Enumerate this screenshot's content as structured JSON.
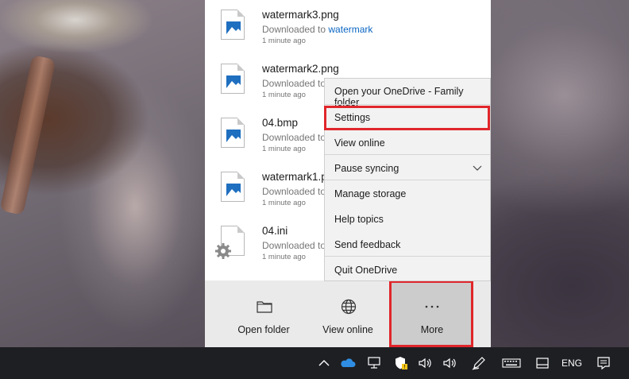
{
  "files": [
    {
      "name": "watermark3.png",
      "status_prefix": "Downloaded to ",
      "location": "watermark",
      "time": "1 minute ago",
      "icon": "image-file-icon"
    },
    {
      "name": "watermark2.png",
      "status_prefix": "Downloaded to",
      "location": "",
      "time": "1 minute ago",
      "icon": "image-file-icon"
    },
    {
      "name": "04.bmp",
      "status_prefix": "Downloaded to",
      "location": "",
      "time": "1 minute ago",
      "icon": "image-file-icon"
    },
    {
      "name": "watermark1.p",
      "status_prefix": "Downloaded to",
      "location": "",
      "time": "1 minute ago",
      "icon": "image-file-icon"
    },
    {
      "name": "04.ini",
      "status_prefix": "Downloaded to",
      "location": "",
      "time": "1 minute ago",
      "icon": "settings-file-icon"
    }
  ],
  "actions": {
    "open_folder": {
      "label": "Open folder",
      "icon": "folder-icon"
    },
    "view_online": {
      "label": "View online",
      "icon": "globe-icon"
    },
    "more": {
      "label": "More",
      "icon": "ellipsis-icon"
    }
  },
  "menu": {
    "items": [
      {
        "label": "Open your OneDrive - Family folder"
      },
      {
        "label": "Settings"
      },
      {
        "label": "View online"
      },
      {
        "label": "Pause syncing",
        "has_submenu": true
      },
      {
        "label": "Manage storage"
      },
      {
        "label": "Help topics"
      },
      {
        "label": "Send feedback"
      },
      {
        "label": "Quit OneDrive"
      }
    ]
  },
  "taskbar": {
    "language": "ENG",
    "icons": [
      "chevron-up-icon",
      "onedrive-cloud-icon",
      "network-icon",
      "security-shield-icon",
      "volume-icon",
      "volume-icon",
      "pen-icon",
      "keyboard-icon",
      "tablet-mode-icon",
      "notification-icon"
    ]
  },
  "colors": {
    "accent": "#0a65c2",
    "highlight": "#e0262b",
    "taskbar": "#1e1f23"
  }
}
